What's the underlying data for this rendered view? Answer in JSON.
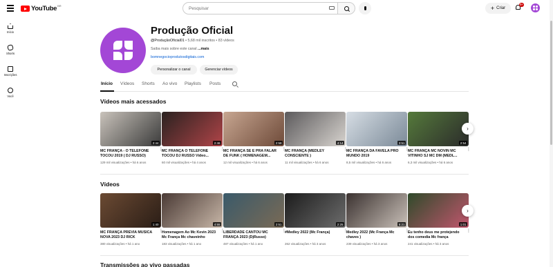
{
  "header": {
    "logo_text": "YouTube",
    "logo_country": "BR",
    "search_placeholder": "Pesquisar",
    "create_label": "Criar",
    "notif_count": "9+"
  },
  "sidenav": [
    {
      "label": "Início",
      "icon": "home-icon"
    },
    {
      "label": "Shorts",
      "icon": "shorts-icon"
    },
    {
      "label": "Inscrições",
      "icon": "subscriptions-icon"
    },
    {
      "label": "Você",
      "icon": "you-icon"
    }
  ],
  "channel": {
    "title": "Produção Oficial",
    "handle": "@ProduçãoOficial01",
    "subscribers": "5,68 mil inscritos",
    "videos_count": "83 vídeos",
    "desc": "Saiba mais sobre este canal",
    "more": "...mais",
    "link": "bomnegocioprodutosdigitais.com",
    "btn_customize": "Personalizar o canal",
    "btn_manage": "Gerenciar vídeos",
    "brand_color": "#a347d6"
  },
  "tabs": [
    "Início",
    "Vídeos",
    "Shorts",
    "Ao vivo",
    "Playlists",
    "Posts"
  ],
  "sections": {
    "popular_title": "Vídeos mais acessados",
    "videos_title": "Vídeos",
    "live_title": "Transmissões ao vivo passadas"
  },
  "popular": [
    {
      "title": "MC FRANÇA - O TELEFONE TOCOU 2019 ( DJ RUSSO)",
      "views": "129 mil visualizações",
      "age": "há 6 anos",
      "duration": "2:44",
      "c1": "#c9c3bb",
      "c2": "#3a3a3a"
    },
    {
      "title": "MC FRANÇA O TELEFONE TOCOU DJ RUSSO Vídeo...",
      "views": "60 mil visualizações",
      "age": "há 4 anos",
      "duration": "2:46",
      "c1": "#2a2220",
      "c2": "#b04448"
    },
    {
      "title": "MC FRANÇA SE É PRA FALAR DE FUNK ( HOMENAGEM...",
      "views": "12 mil visualizações",
      "age": "há 6 anos",
      "duration": "2:58",
      "c1": "#c7a691",
      "c2": "#6e4a39"
    },
    {
      "title": "MC FRANÇA (MEDLEY CONSCIENTE )",
      "views": "11 mil visualizações",
      "age": "há 6 anos",
      "duration": "4:14",
      "c1": "#5c5a5c",
      "c2": "#d8d4cf"
    },
    {
      "title": "MC FRANÇA DA FAVELA PRO MUNDO 2019",
      "views": "8,5 mil visualizações",
      "age": "há 6 anos",
      "duration": "3:51",
      "c1": "#d6dde4",
      "c2": "#7b8a98"
    },
    {
      "title": "MC FRANÇA MC NOVIN MC VITINHO SJ MC DM (MEDL...",
      "views": "6,3 mil visualizações",
      "age": "há 6 anos",
      "duration": "2:54",
      "c1": "#557a3b",
      "c2": "#2b2b2b"
    }
  ],
  "videos": [
    {
      "title": "MC FRANÇA PREVIA MUSICA NOVA 2023 DJ RICK",
      "views": "380 visualizações",
      "age": "há 1 ano",
      "duration": "1:40",
      "c1": "#6b4a33",
      "c2": "#2a1d16"
    },
    {
      "title": "Homenagem Ao Mc Kevin 2023 Mc França Mc chaveinho",
      "views": "183 visualizações",
      "age": "há 1 ano",
      "duration": "4:55",
      "c1": "#4a3a35",
      "c2": "#c8b7a8"
    },
    {
      "title": "LIBERDADE CANTOU MC FRANÇA 2023 (DjRusso)",
      "views": "487 visualizações",
      "age": "há 1 ano",
      "duration": "2:51",
      "c1": "#3a5a6a",
      "c2": "#7a6a55"
    },
    {
      "title": "#Medley 2022 (Mc França)",
      "views": "262 visualizações",
      "age": "há 3 anos",
      "duration": "2:25",
      "c1": "#1c1c1c",
      "c2": "#6d6d6d"
    },
    {
      "title": "Medley 2022 (Mc França Mc chaves )",
      "views": "239 visualizações",
      "age": "há 3 anos",
      "duration": "5:21",
      "c1": "#3b3230",
      "c2": "#c9c0b8"
    },
    {
      "title": "Eu tenho deus me protejendo dos comedia Mc frança",
      "views": "241 visualizações",
      "age": "há 3 anos",
      "duration": "1:01",
      "c1": "#2f4a2a",
      "c2": "#c2566e"
    }
  ]
}
